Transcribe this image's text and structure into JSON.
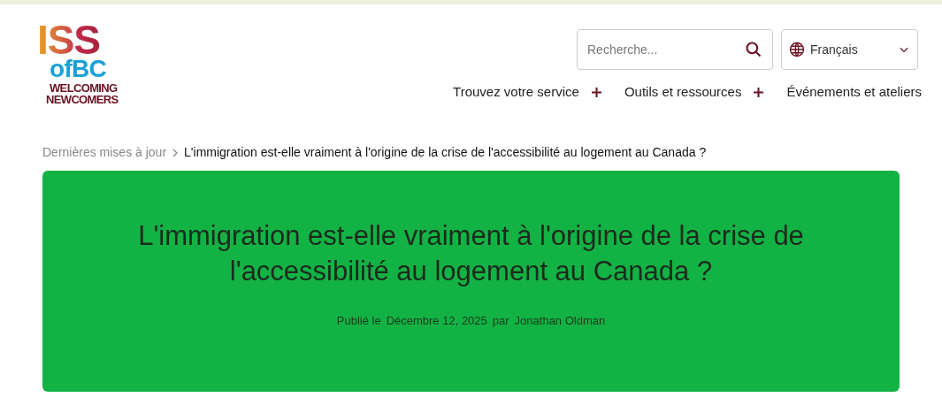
{
  "logo": {
    "line_1": "ISS",
    "line_2": "ofBC",
    "line_3": "WELCOMING",
    "line_4": "NEWCOMERS"
  },
  "search": {
    "placeholder": "Recherche..."
  },
  "language": {
    "value": "Français"
  },
  "nav": [
    {
      "label": "Trouvez votre service",
      "expandable": true
    },
    {
      "label": "Outils et ressources",
      "expandable": true
    },
    {
      "label": "Événements et ateliers",
      "expandable": false
    }
  ],
  "breadcrumb": [
    {
      "label": "Dernières mises à jour",
      "current": false
    },
    {
      "label": "L'immigration est-elle vraiment à l'origine de la crise de l'accessibilité au logement au Canada ?",
      "current": true
    }
  ],
  "hero": {
    "title": "L'immigration est-elle vraiment à l'origine de la crise de l'accessibilité au logement au Canada ?",
    "published_label": "Publié le",
    "date": "Décembre 12, 2025",
    "by_label": "par",
    "author": "Jonathan Oldman"
  }
}
